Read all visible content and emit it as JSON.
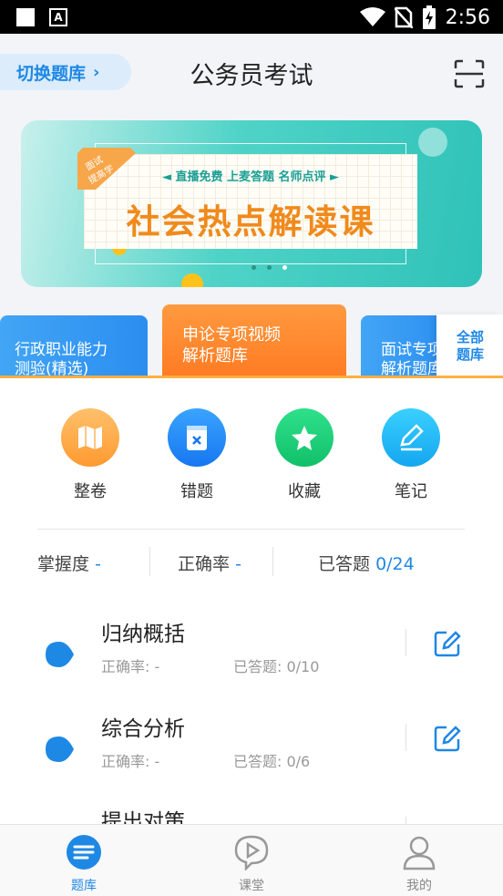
{
  "status_bar": {
    "time": "2:56",
    "icons": [
      "square-icon",
      "a-icon",
      "wifi-icon",
      "no-sim-icon",
      "battery-charging-icon"
    ]
  },
  "header": {
    "switch_label": "切换题库",
    "title": "公务员考试",
    "scan_icon": "scan-icon"
  },
  "banner": {
    "subtitle": "◄ 直播免费 上麦答题 名师点评 ►",
    "headline": "社会热点解读课",
    "ribbon": "面试提高学",
    "active_dot": 2,
    "dot_count": 3,
    "colors": {
      "teal": "#2fc2b8",
      "orange": "#f08a1c"
    }
  },
  "categories": [
    {
      "line1": "行政职业能力",
      "line2": "测验(精选)",
      "active": false
    },
    {
      "line1": "申论专项视频",
      "line2": "解析题库",
      "active": true
    },
    {
      "line1": "面试专项",
      "line2": "解析题库",
      "active": false
    }
  ],
  "all_bank": {
    "line1": "全部",
    "line2": "题库"
  },
  "quick_actions": [
    {
      "label": "整卷",
      "icon": "map-icon"
    },
    {
      "label": "错题",
      "icon": "wrong-book-icon"
    },
    {
      "label": "收藏",
      "icon": "star-icon"
    },
    {
      "label": "笔记",
      "icon": "pen-icon"
    }
  ],
  "stats": {
    "mastery_label": "掌握度",
    "mastery_value": "-",
    "accuracy_label": "正确率",
    "accuracy_value": "-",
    "answered_label": "已答题",
    "answered_value": "0/24"
  },
  "topics": [
    {
      "name": "归纳概括",
      "accuracy": "正确率: -",
      "answered": "已答题: 0/10"
    },
    {
      "name": "综合分析",
      "accuracy": "正确率: -",
      "answered": "已答题: 0/6"
    },
    {
      "name": "提出对策",
      "accuracy": "",
      "answered": ""
    }
  ],
  "tabbar": [
    {
      "label": "题库",
      "icon": "question-bank-icon",
      "active": true
    },
    {
      "label": "课堂",
      "icon": "play-chat-icon",
      "active": false
    },
    {
      "label": "我的",
      "icon": "user-icon",
      "active": false
    }
  ],
  "accent_color": "#1e88e5"
}
